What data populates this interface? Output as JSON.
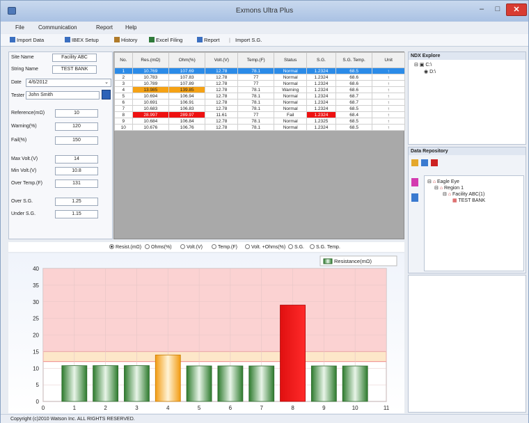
{
  "window": {
    "title": "Exmons Ultra Plus",
    "minimize": "–",
    "maximize": "□",
    "close": "✕"
  },
  "menu": [
    "File",
    "Communication",
    "Report",
    "Help"
  ],
  "toolbar": {
    "import_data": "Import Data",
    "ibex_setup": "IBEX Setup",
    "history": "History",
    "excel_filing": "Excel Filing",
    "report": "Report",
    "import_sg": "Import S.G."
  },
  "form": {
    "site_name_label": "Site Name",
    "site_name": "Facility ABC",
    "string_name_label": "String Name",
    "string_name": "TEST BANK",
    "date_label": "Date",
    "date": "4/6/2012",
    "tester_label": "Tester",
    "tester": "John Smith",
    "reference_label": "Reference(mΩ)",
    "reference": "10",
    "warning_label": "Warning(%)",
    "warning": "120",
    "fail_label": "Fail(%)",
    "fail": "150",
    "max_volt_label": "Max Volt.(V)",
    "max_volt": "14",
    "min_volt_label": "Min Volt.(V)",
    "min_volt": "10.8",
    "over_temp_label": "Over Temp.(F)",
    "over_temp": "131",
    "over_sg_label": "Over S.G.",
    "over_sg": "1.25",
    "under_sg_label": "Under S.G.",
    "under_sg": "1.15"
  },
  "table": {
    "headers": [
      "No.",
      "Res.(mΩ)",
      "Ohm(%)",
      "Volt.(V)",
      "Temp.(F)",
      "Status",
      "S.G.",
      "S.G. Temp.",
      "Unit"
    ],
    "rows": [
      [
        "1",
        "10.769",
        "107.69",
        "12.78",
        "78.1",
        "Normal",
        "1.2324",
        "68.5",
        "↑"
      ],
      [
        "2",
        "10.783",
        "107.83",
        "12.78",
        "77",
        "Normal",
        "1.2324",
        "68.6",
        "↑"
      ],
      [
        "3",
        "10.789",
        "107.89",
        "12.78",
        "77",
        "Normal",
        "1.2324",
        "68.6",
        "↑"
      ],
      [
        "4",
        "13.985",
        "139.85",
        "12.78",
        "78.1",
        "Warning",
        "1.2324",
        "68.6",
        "↑"
      ],
      [
        "5",
        "10.694",
        "106.94",
        "12.78",
        "78.1",
        "Normal",
        "1.2324",
        "68.7",
        "↑"
      ],
      [
        "6",
        "10.691",
        "106.91",
        "12.78",
        "78.1",
        "Normal",
        "1.2324",
        "68.7",
        "↑"
      ],
      [
        "7",
        "10.683",
        "106.83",
        "12.78",
        "78.1",
        "Normal",
        "1.2324",
        "68.5",
        "↑"
      ],
      [
        "8",
        "28.997",
        "289.97",
        "11.61",
        "77",
        "Fail",
        "1.2324",
        "68.4",
        "↑"
      ],
      [
        "9",
        "10.684",
        "106.84",
        "12.78",
        "78.1",
        "Normal",
        "1.2325",
        "68.5",
        "↑"
      ],
      [
        "10",
        "10.676",
        "106.76",
        "12.78",
        "78.1",
        "Normal",
        "1.2324",
        "68.5",
        "↑"
      ]
    ]
  },
  "radios": [
    "Resist.(mΩ)",
    "Ohms(%)",
    "Volt.(V)",
    "Temp.(F)",
    "Volt. +Ohms(%)",
    "S.G.",
    "S.G. Temp."
  ],
  "explorer": {
    "title": "NDX Explore",
    "items": [
      "C:\\",
      "D:\\"
    ]
  },
  "repository": {
    "title": "Data Repository",
    "items": [
      "Eagle Eye",
      "Region 1",
      "Facility ABC(1)",
      "TEST BANK"
    ]
  },
  "status": "Copyright (c)2010 Watson Inc. ALL RIGHTS RESERVED.",
  "colors": {
    "normal_bar": "#3e9a3e",
    "warning_bar": "#f5a623",
    "fail_bar": "#ee1111",
    "selected_row": "#2b8be8",
    "fail_band": "#fbd2d2",
    "warning_band": "#fde7c9"
  },
  "chart_data": {
    "type": "bar",
    "legend": "Resistance(mΩ)",
    "legend_position": "top-right",
    "categories": [
      1,
      2,
      3,
      4,
      5,
      6,
      7,
      8,
      9,
      10
    ],
    "values": [
      10.769,
      10.783,
      10.789,
      13.985,
      10.694,
      10.691,
      10.683,
      28.997,
      10.684,
      10.676
    ],
    "xlim": [
      0,
      11
    ],
    "ylim": [
      0,
      40
    ],
    "xticks": [
      0,
      1,
      2,
      3,
      4,
      5,
      6,
      7,
      8,
      9,
      10,
      11
    ],
    "yticks": [
      0,
      5,
      10,
      15,
      20,
      25,
      30,
      35,
      40
    ],
    "warning_threshold": 12,
    "fail_threshold": 15,
    "grid": true
  }
}
